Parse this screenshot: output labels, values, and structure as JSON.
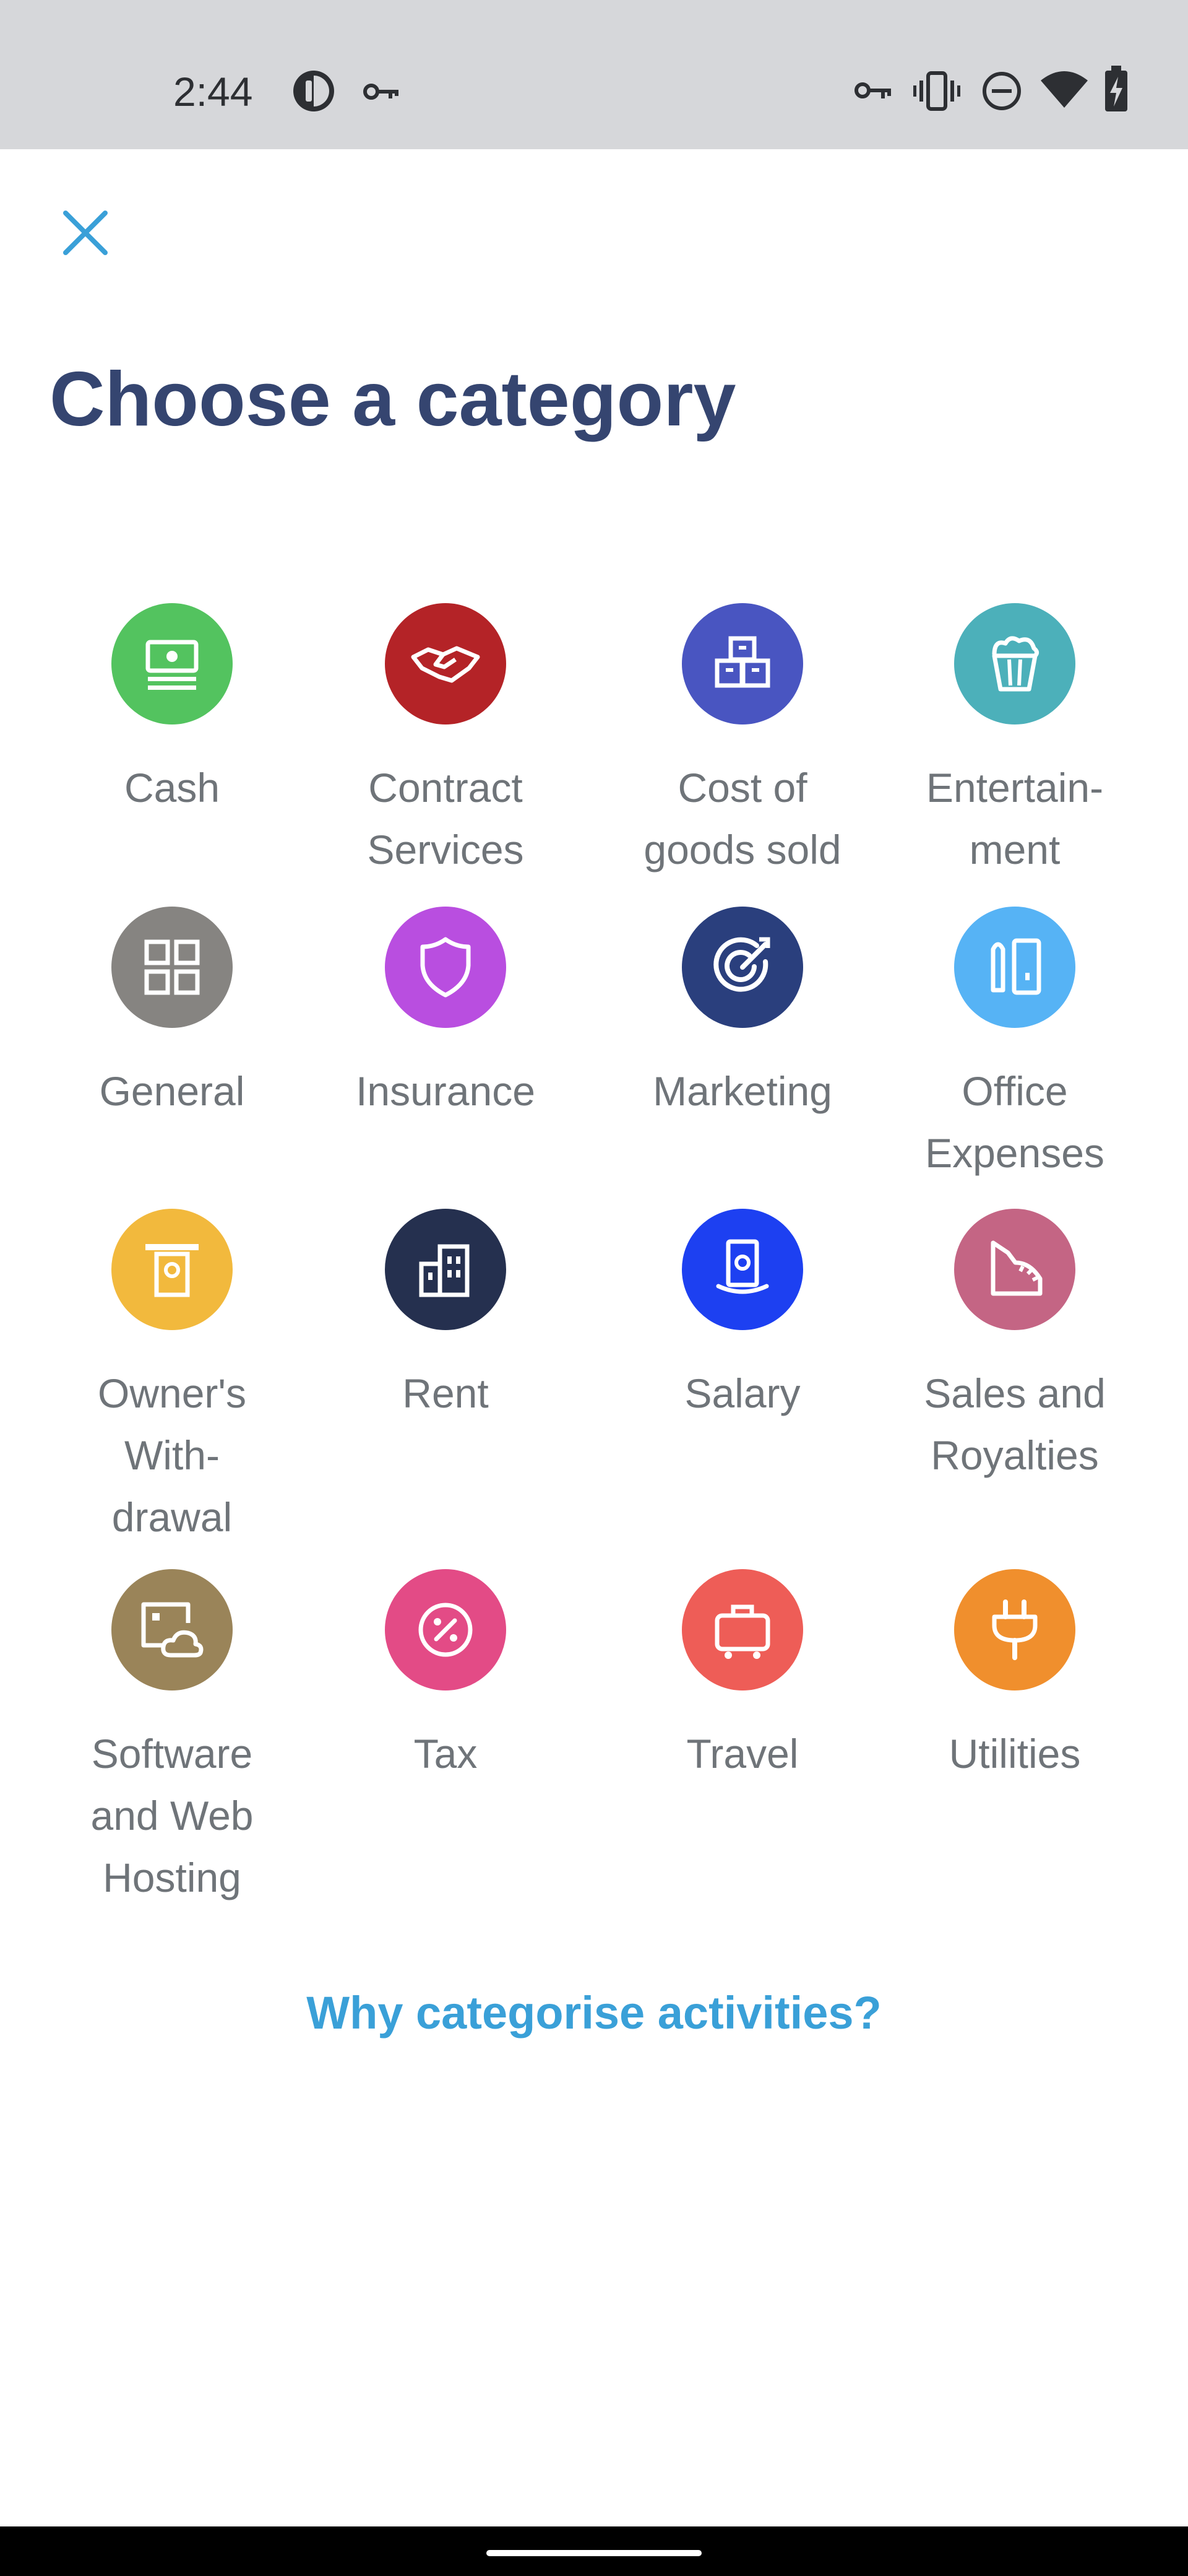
{
  "status_bar": {
    "time": "2:44",
    "icons": [
      "media-app-icon",
      "vpn-key-icon",
      "vpn-key-icon",
      "vibrate-icon",
      "do-not-disturb-icon",
      "wifi-icon",
      "battery-charging-icon"
    ]
  },
  "header": {
    "close_icon": "close-icon",
    "title": "Choose a category"
  },
  "categories": [
    {
      "label": "Cash",
      "icon": "cash-icon",
      "color": "#53c35f"
    },
    {
      "label": "Contract\nServices",
      "icon": "handshake-icon",
      "color": "#b42327"
    },
    {
      "label": "Cost of\ngoods sold",
      "icon": "boxes-icon",
      "color": "#4955c1"
    },
    {
      "label": "Entertain-\nment",
      "icon": "popcorn-icon",
      "color": "#4cb0ba"
    },
    {
      "label": "General",
      "icon": "grid-icon",
      "color": "#868481"
    },
    {
      "label": "Insurance",
      "icon": "shield-icon",
      "color": "#b94ee0"
    },
    {
      "label": "Marketing",
      "icon": "target-icon",
      "color": "#2a3f7d"
    },
    {
      "label": "Office\nExpenses",
      "icon": "pencil-notebook-icon",
      "color": "#56b3f5"
    },
    {
      "label": "Owner's\nWith-\ndrawal",
      "icon": "withdrawal-icon",
      "color": "#f2b93d"
    },
    {
      "label": "Rent",
      "icon": "building-icon",
      "color": "#25304f"
    },
    {
      "label": "Salary",
      "icon": "salary-icon",
      "color": "#1d40f1"
    },
    {
      "label": "Sales and\nRoyalties",
      "icon": "sales-chart-icon",
      "color": "#c46584"
    },
    {
      "label": "Software\nand Web\nHosting",
      "icon": "cloud-image-icon",
      "color": "#9a8459"
    },
    {
      "label": "Tax",
      "icon": "percent-icon",
      "color": "#e34b86"
    },
    {
      "label": "Travel",
      "icon": "suitcase-icon",
      "color": "#ee5d57"
    },
    {
      "label": "Utilities",
      "icon": "plug-icon",
      "color": "#f08f2d"
    }
  ],
  "footer": {
    "why_link": "Why categorise activities?"
  },
  "colors": {
    "title": "#354570",
    "label": "#6f7479",
    "link": "#3aa0d8",
    "close": "#3aa0d8",
    "status_bar_bg": "#d6d7da"
  }
}
